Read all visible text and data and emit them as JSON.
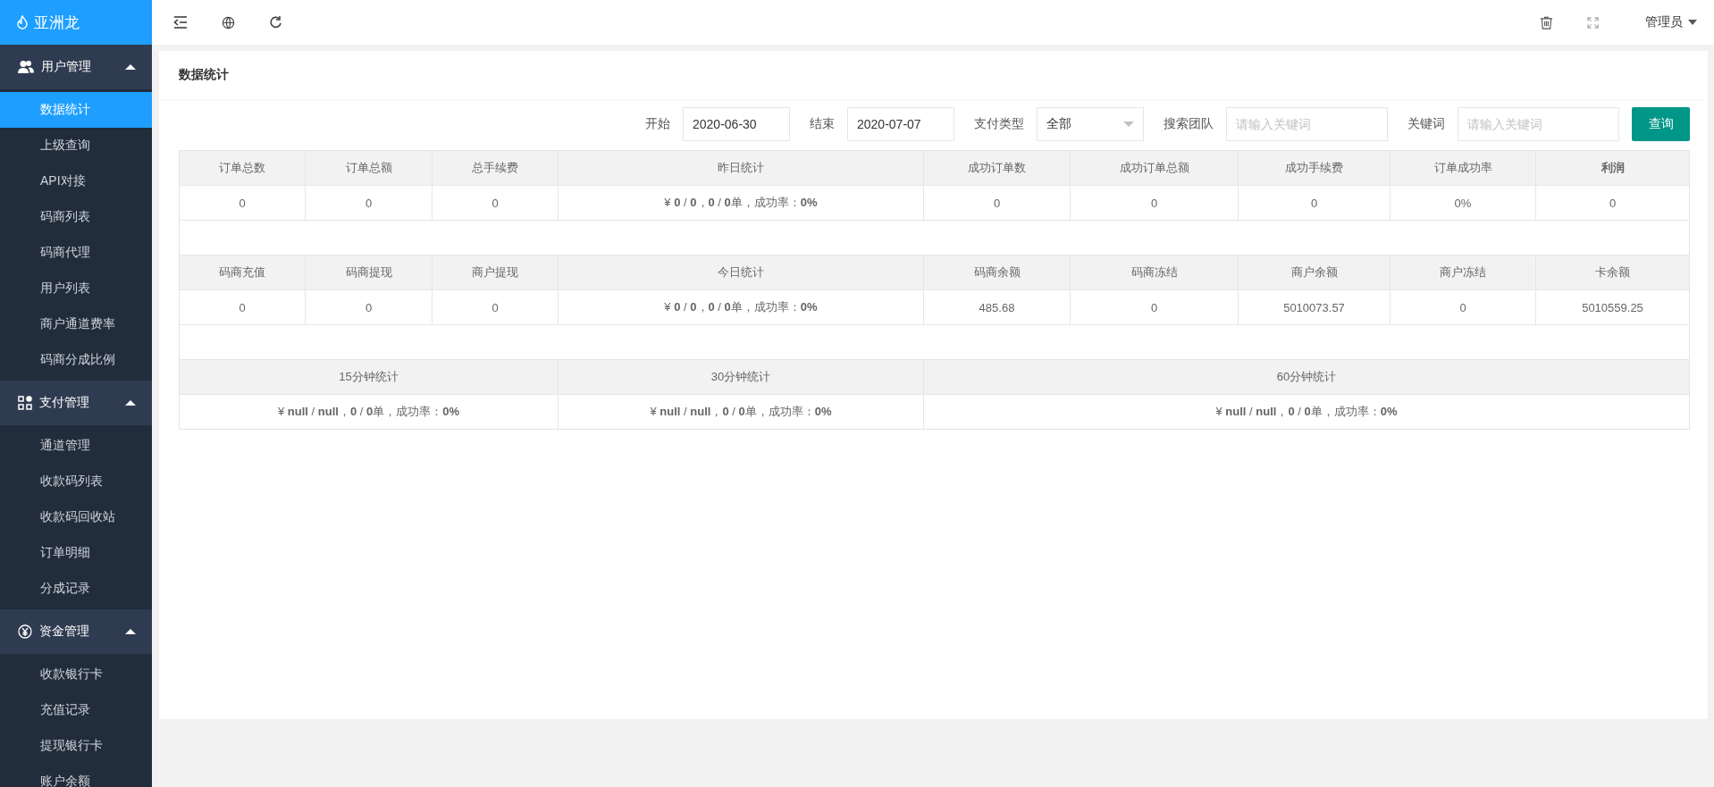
{
  "brand": {
    "name": "亚洲龙"
  },
  "topbar": {
    "user": "管理员"
  },
  "sidebar": {
    "groups": [
      {
        "label": "用户管理",
        "expanded": true,
        "items": [
          {
            "label": "数据统计",
            "selected": true
          },
          {
            "label": "上级查询",
            "selected": false
          },
          {
            "label": "API对接",
            "selected": false
          },
          {
            "label": "码商列表",
            "selected": false
          },
          {
            "label": "码商代理",
            "selected": false
          },
          {
            "label": "用户列表",
            "selected": false
          },
          {
            "label": "商户通道费率",
            "selected": false
          },
          {
            "label": "码商分成比例",
            "selected": false
          }
        ]
      },
      {
        "label": "支付管理",
        "expanded": true,
        "items": [
          {
            "label": "通道管理",
            "selected": false
          },
          {
            "label": "收款码列表",
            "selected": false
          },
          {
            "label": "收款码回收站",
            "selected": false
          },
          {
            "label": "订单明细",
            "selected": false
          },
          {
            "label": "分成记录",
            "selected": false
          }
        ]
      },
      {
        "label": "资金管理",
        "expanded": true,
        "items": [
          {
            "label": "收款银行卡",
            "selected": false
          },
          {
            "label": "充值记录",
            "selected": false
          },
          {
            "label": "提现银行卡",
            "selected": false
          },
          {
            "label": "账户余额",
            "selected": false
          }
        ]
      }
    ]
  },
  "page": {
    "title": "数据统计"
  },
  "filters": {
    "start_label": "开始",
    "start": "2020-06-30",
    "end_label": "结束",
    "end": "2020-07-07",
    "pay_type_label": "支付类型",
    "pay_type": "全部",
    "team_label": "搜索团队",
    "team_placeholder": "请输入关键词",
    "keyword_label": "关键词",
    "keyword_placeholder": "请输入关键词",
    "button": "查询"
  },
  "stats_table": {
    "sections": [
      {
        "kind": "daily",
        "headers": [
          {
            "text": "订单总数",
            "bold": false
          },
          {
            "text": "订单总额",
            "bold": false
          },
          {
            "text": "总手续费",
            "bold": false
          },
          {
            "text": "昨日统计",
            "bold": false
          },
          {
            "text": "成功订单数",
            "bold": false
          },
          {
            "text": "成功订单总额",
            "bold": false
          },
          {
            "text": "成功手续费",
            "bold": false
          },
          {
            "text": "订单成功率",
            "bold": false
          },
          {
            "text": "利润",
            "bold": true
          }
        ],
        "values": [
          "0",
          "0",
          "0",
          "¥ **0** / **0**，**0** / **0**单，成功率：**0%**",
          "0",
          "0",
          "0",
          "0%",
          "0"
        ]
      },
      {
        "kind": "daily",
        "headers": [
          {
            "text": "码商充值",
            "bold": false
          },
          {
            "text": "码商提现",
            "bold": false
          },
          {
            "text": "商户提现",
            "bold": false
          },
          {
            "text": "今日统计",
            "bold": false
          },
          {
            "text": "码商余额",
            "bold": false
          },
          {
            "text": "码商冻结",
            "bold": false
          },
          {
            "text": "商户余额",
            "bold": false
          },
          {
            "text": "商户冻结",
            "bold": false
          },
          {
            "text": "卡余额",
            "bold": false
          }
        ],
        "values": [
          "0",
          "0",
          "0",
          "¥ **0** / **0**，**0** / **0**单，成功率：**0%**",
          "485.68",
          "0",
          "5010073.57",
          "0",
          "5010559.25"
        ]
      },
      {
        "kind": "window",
        "headers": [
          {
            "text": "15分钟统计",
            "bold": false
          },
          {
            "text": "30分钟统计",
            "bold": false
          },
          {
            "text": "60分钟统计",
            "bold": false
          }
        ],
        "values": [
          "¥ **null** / **null**，**0** / **0**单，成功率：**0%**",
          "¥ **null** / **null**，**0** / **0**单，成功率：**0%**",
          "¥ **null** / **null**，**0** / **0**单，成功率：**0%**"
        ]
      }
    ]
  }
}
